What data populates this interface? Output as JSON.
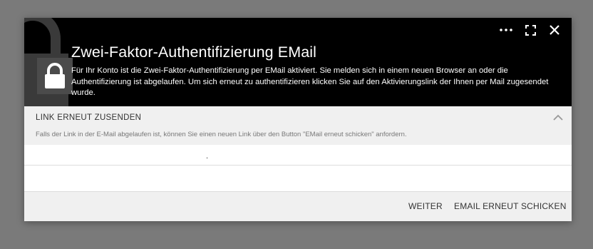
{
  "dialog": {
    "title": "Zwei-Faktor-Authentifizierung EMail",
    "description": "Für Ihr Konto ist die Zwei-Faktor-Authentifizierung per EMail aktiviert. Sie melden sich in einem neuen Browser an oder die Authentifizierung ist abgelaufen. Um sich erneut zu authentifizieren klicken Sie auf den Aktivierungslink der Ihnen per Mail zugesendet wurde.",
    "header_actions": [
      {
        "icon": "more-icon"
      },
      {
        "icon": "fullscreen-icon"
      },
      {
        "icon": "close-icon"
      }
    ]
  },
  "section": {
    "title": "LINK ERNEUT ZUSENDEN",
    "note": "Falls der Link in der E-Mail abgelaufen ist, können Sie einen neuen Link über den Button \"EMail erneut schicken\" anfordern.",
    "collapse_icon": "chevron-up-icon"
  },
  "field": {
    "value": "."
  },
  "footer": {
    "weiter_label": "WEITER",
    "resend_label": "EMAIL ERNEUT SCHICKEN"
  },
  "colors": {
    "header_bg": "#000000",
    "section_bg": "#f0f0f0",
    "overlay": "#7a7a7a"
  }
}
